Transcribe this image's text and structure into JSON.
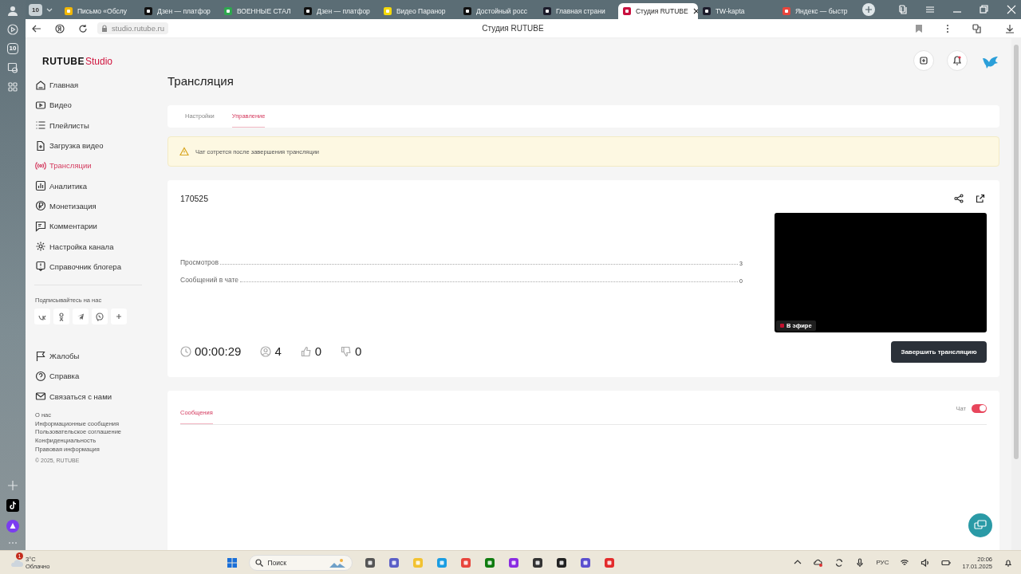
{
  "browser": {
    "tab_count": "10",
    "tabs": [
      {
        "title": "Письмо «Обслу",
        "color": "#f2b705",
        "selected": false
      },
      {
        "title": "Дзен — платфор",
        "color": "#111111",
        "selected": false
      },
      {
        "title": "ВОЕННЫЕ СТАЛ",
        "color": "#2fa84f",
        "selected": false
      },
      {
        "title": "Дзен — платфор",
        "color": "#111111",
        "selected": false
      },
      {
        "title": "Видео Паранор",
        "color": "#f5d90a",
        "selected": false
      },
      {
        "title": "Достойный росс",
        "color": "#111111",
        "selected": false
      },
      {
        "title": "Главная страни",
        "color": "#1c1c2b",
        "selected": false
      },
      {
        "title": "Студия RUTUBE",
        "color": "#c8103e",
        "selected": true
      },
      {
        "title": "TW-kapta",
        "color": "#1c1c2b",
        "selected": false
      },
      {
        "title": "Яндекс — быстр",
        "color": "#e8453c",
        "selected": false
      }
    ],
    "address": "studio.rutube.ru",
    "page_title": "Студия RUTUBE",
    "side_badge": "10"
  },
  "app": {
    "logo": {
      "brand": "RUTUBE",
      "product": "Studio"
    },
    "nav": [
      {
        "label": "Главная",
        "selected": false
      },
      {
        "label": "Видео",
        "selected": false
      },
      {
        "label": "Плейлисты",
        "selected": false
      },
      {
        "label": "Загрузка видео",
        "selected": false
      },
      {
        "label": "Трансляции",
        "selected": true
      },
      {
        "label": "Аналитика",
        "selected": false
      },
      {
        "label": "Монетизация",
        "selected": false
      },
      {
        "label": "Комментарии",
        "selected": false
      },
      {
        "label": "Настройка канала",
        "selected": false
      },
      {
        "label": "Справочник блогера",
        "selected": false
      }
    ],
    "social_label": "Подписывайтесь на нас",
    "support": [
      {
        "label": "Жалобы"
      },
      {
        "label": "Справка"
      },
      {
        "label": "Связаться с нами"
      }
    ],
    "footer_links": [
      "О нас",
      "Информационные сообщения",
      "Пользовательское соглашение",
      "Конфиденциальность",
      "Правовая информация"
    ],
    "copyright": "© 2025, RUTUBE"
  },
  "page": {
    "title": "Трансляция",
    "tabs": [
      {
        "label": "Настройки",
        "selected": false
      },
      {
        "label": "Управление",
        "selected": true
      }
    ],
    "notice": "Чат сотрется после завершения трансляции",
    "stream": {
      "title": "170525",
      "stats": [
        {
          "label": "Просмотров",
          "value": "3"
        },
        {
          "label": "Сообщений в чате",
          "value": "0"
        }
      ],
      "duration": "00:00:29",
      "viewers": "4",
      "likes": "0",
      "dislikes": "0",
      "live_badge": "В эфире",
      "end_button": "Завершить трансляцию"
    },
    "chat": {
      "tabs": [
        {
          "label": "Сообщения",
          "selected": true
        }
      ],
      "toggle_label": "Чат",
      "on": true
    }
  },
  "taskbar": {
    "temperature": "3°C",
    "weather": "Облачно",
    "weather_alert": "1",
    "search_placeholder": "Поиск",
    "language": "РУС",
    "time": "20:06",
    "date": "17.01.2025"
  }
}
